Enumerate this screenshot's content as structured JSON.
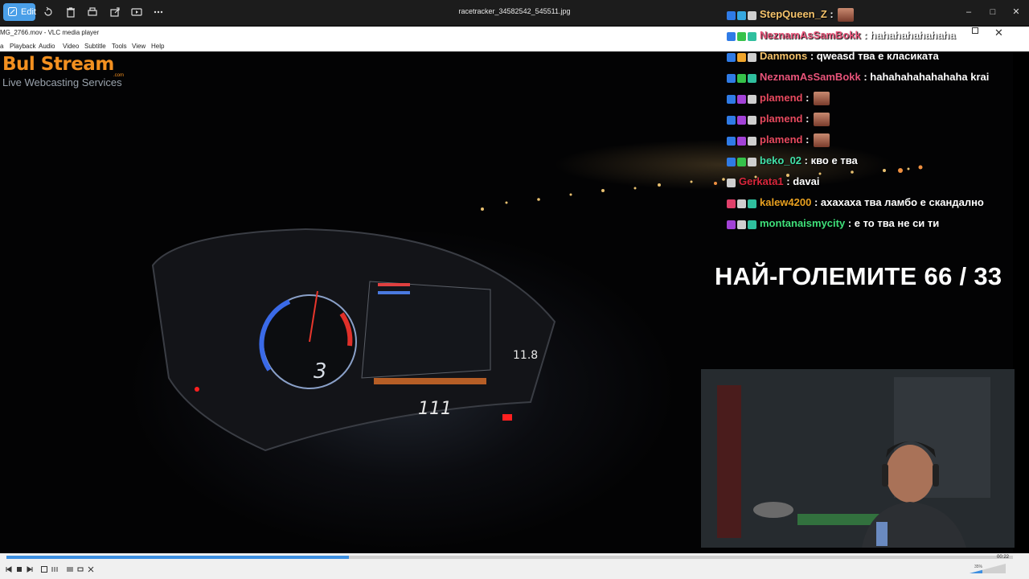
{
  "photos_app": {
    "edit_label": "Edit",
    "filename": "racetracker_34582542_545511.jpg",
    "toolbar_icons": [
      "rotate-icon",
      "delete-icon",
      "print-icon",
      "share-icon",
      "slideshow-icon",
      "more-icon"
    ]
  },
  "vlc": {
    "title": "MG_2766.mov - VLC media player",
    "menu": [
      "a",
      "Playback",
      "Audio",
      "Video",
      "Subtitle",
      "Tools",
      "View",
      "Help"
    ],
    "time_elapsed": "00:22",
    "volume": "35%",
    "progress_fraction": 0.34
  },
  "overlay": {
    "logo_main": "Bul Stream",
    "logo_com": ".com",
    "logo_sub": "Live Webcasting Services",
    "title": "НАЙ-ГОЛЕМИТЕ 66 / 33"
  },
  "chat": [
    {
      "user": "StepQueen_Z",
      "color": "#f5c36b",
      "msg": "",
      "emote": true,
      "badges": [
        "#2f7be6",
        "#36a8e0",
        "#cfcfcf"
      ]
    },
    {
      "user": "NeznamAsSamBokk",
      "color": "#e8547a",
      "msg": "hahahahahahaha",
      "emote": false,
      "badges": [
        "#2f7be6",
        "#36c24a",
        "#2fbf9e"
      ]
    },
    {
      "user": "Danmons",
      "color": "#f5c36b",
      "msg": "qweasd тва е класиката",
      "emote": false,
      "badges": [
        "#2f7be6",
        "#f0a52b",
        "#cfcfcf"
      ]
    },
    {
      "user": "NeznamAsSamBokk",
      "color": "#e8547a",
      "msg": "hahahahahahahaha krai",
      "emote": false,
      "badges": [
        "#2f7be6",
        "#36c24a",
        "#2fbf9e"
      ]
    },
    {
      "user": "plamend",
      "color": "#e84a5f",
      "msg": "",
      "emote": true,
      "badges": [
        "#2f7be6",
        "#a242d6",
        "#cfcfcf"
      ]
    },
    {
      "user": "plamend",
      "color": "#e84a5f",
      "msg": "",
      "emote": true,
      "badges": [
        "#2f7be6",
        "#a242d6",
        "#cfcfcf"
      ]
    },
    {
      "user": "plamend",
      "color": "#e84a5f",
      "msg": "",
      "emote": true,
      "badges": [
        "#2f7be6",
        "#a242d6",
        "#cfcfcf"
      ]
    },
    {
      "user": "beko_02",
      "color": "#41e0a8",
      "msg": "кво е тва",
      "emote": false,
      "badges": [
        "#2f7be6",
        "#36c24a",
        "#cfcfcf"
      ]
    },
    {
      "user": "Gerkata1",
      "color": "#d9263c",
      "msg": "davai",
      "emote": false,
      "badges": [
        "#cfcfcf"
      ]
    },
    {
      "user": "kalew4200",
      "color": "#e8a020",
      "msg": "ахахаха тва ламбо е скандално",
      "emote": false,
      "badges": [
        "#e0406a",
        "#cfcfcf",
        "#2fbf9e"
      ]
    },
    {
      "user": "montanaismycity",
      "color": "#3fe07a",
      "msg": "е то тва не си ти",
      "emote": false,
      "badges": [
        "#a242d6",
        "#cfcfcf",
        "#2fbf9e"
      ]
    }
  ]
}
